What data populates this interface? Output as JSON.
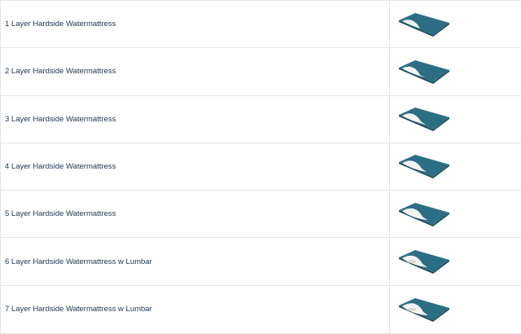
{
  "products": [
    {
      "name": "1 Layer Hardside Watermattress",
      "image_icon": "watermattress-1-layer-icon"
    },
    {
      "name": "2 Layer Hardside Watermattress",
      "image_icon": "watermattress-2-layer-icon"
    },
    {
      "name": "3 Layer Hardside Watermattress",
      "image_icon": "watermattress-3-layer-icon"
    },
    {
      "name": "4 Layer Hardside Watermattress",
      "image_icon": "watermattress-4-layer-icon"
    },
    {
      "name": "5 Layer Hardside Watermattress",
      "image_icon": "watermattress-5-layer-icon"
    },
    {
      "name": "6 Layer Hardside Watermattress w Lumbar",
      "image_icon": "watermattress-6-layer-lumbar-icon"
    },
    {
      "name": "7 Layer Hardside Watermattress w Lumbar",
      "image_icon": "watermattress-7-layer-lumbar-icon"
    }
  ],
  "colors": {
    "mattress_teal": "#2c6f85",
    "mattress_edge": "#1c4a5c",
    "liner_white": "#f4f4f4",
    "text": "#1f3550",
    "border": "#e4e4e4"
  }
}
